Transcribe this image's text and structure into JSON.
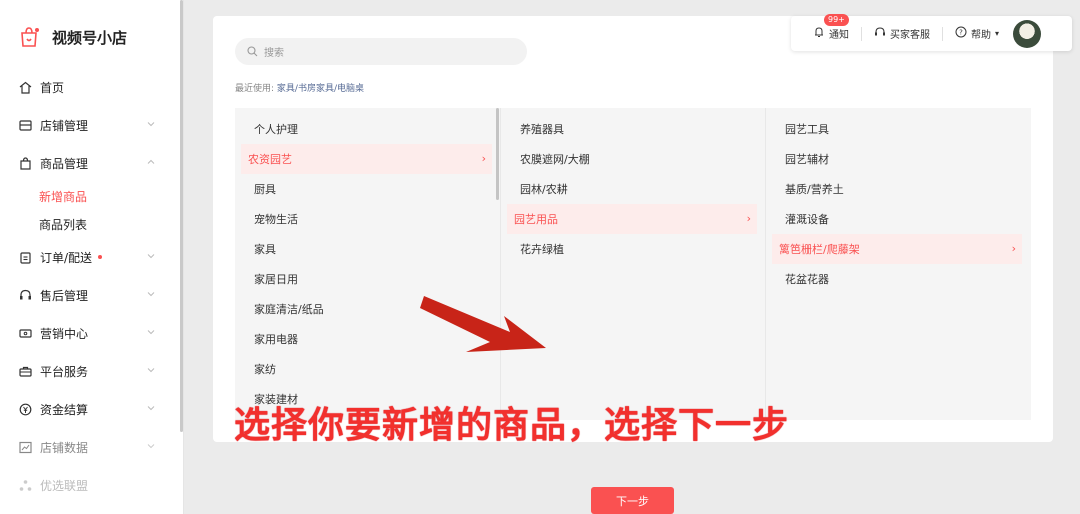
{
  "sidebar": {
    "brand": "视频号小店",
    "items": [
      {
        "label": "首页",
        "icon": "home-icon"
      },
      {
        "label": "店铺管理",
        "icon": "store-icon"
      },
      {
        "label": "商品管理",
        "icon": "bag-icon"
      },
      {
        "label": "订单/配送",
        "icon": "clipboard-icon"
      },
      {
        "label": "售后管理",
        "icon": "headset-icon"
      },
      {
        "label": "营销中心",
        "icon": "ticket-icon"
      },
      {
        "label": "平台服务",
        "icon": "briefcase-icon"
      },
      {
        "label": "资金结算",
        "icon": "yen-icon"
      },
      {
        "label": "店铺数据",
        "icon": "chart-icon"
      },
      {
        "label": "优选联盟",
        "icon": "network-icon"
      }
    ],
    "sub_items": [
      "新增商品",
      "商品列表"
    ]
  },
  "topbar": {
    "notify_label": "通知",
    "notify_badge": "99+",
    "service_label": "买家客服",
    "help_label": "帮助"
  },
  "search": {
    "placeholder": "搜索"
  },
  "recent": {
    "prefix": "最近使用:",
    "path": "家具/书房家具/电脑桌"
  },
  "columns": {
    "col1": [
      "个人护理",
      "农资园艺",
      "厨具",
      "宠物生活",
      "家具",
      "家居日用",
      "家庭清洁/纸品",
      "家用电器",
      "家纺",
      "家装建材"
    ],
    "col2": [
      "养殖器具",
      "农膜遮网/大棚",
      "园林/农耕",
      "园艺用品",
      "花卉绿植"
    ],
    "col3": [
      "园艺工具",
      "园艺辅材",
      "基质/营养土",
      "灌溉设备",
      "篱笆栅栏/爬藤架",
      "花盆花器"
    ]
  },
  "overlay": {
    "text": "选择你要新增的商品，选择下一步"
  },
  "next_button": "下一步",
  "colors": {
    "accent": "#fa5151",
    "link": "#576b95",
    "annotation": "#f2302d"
  }
}
